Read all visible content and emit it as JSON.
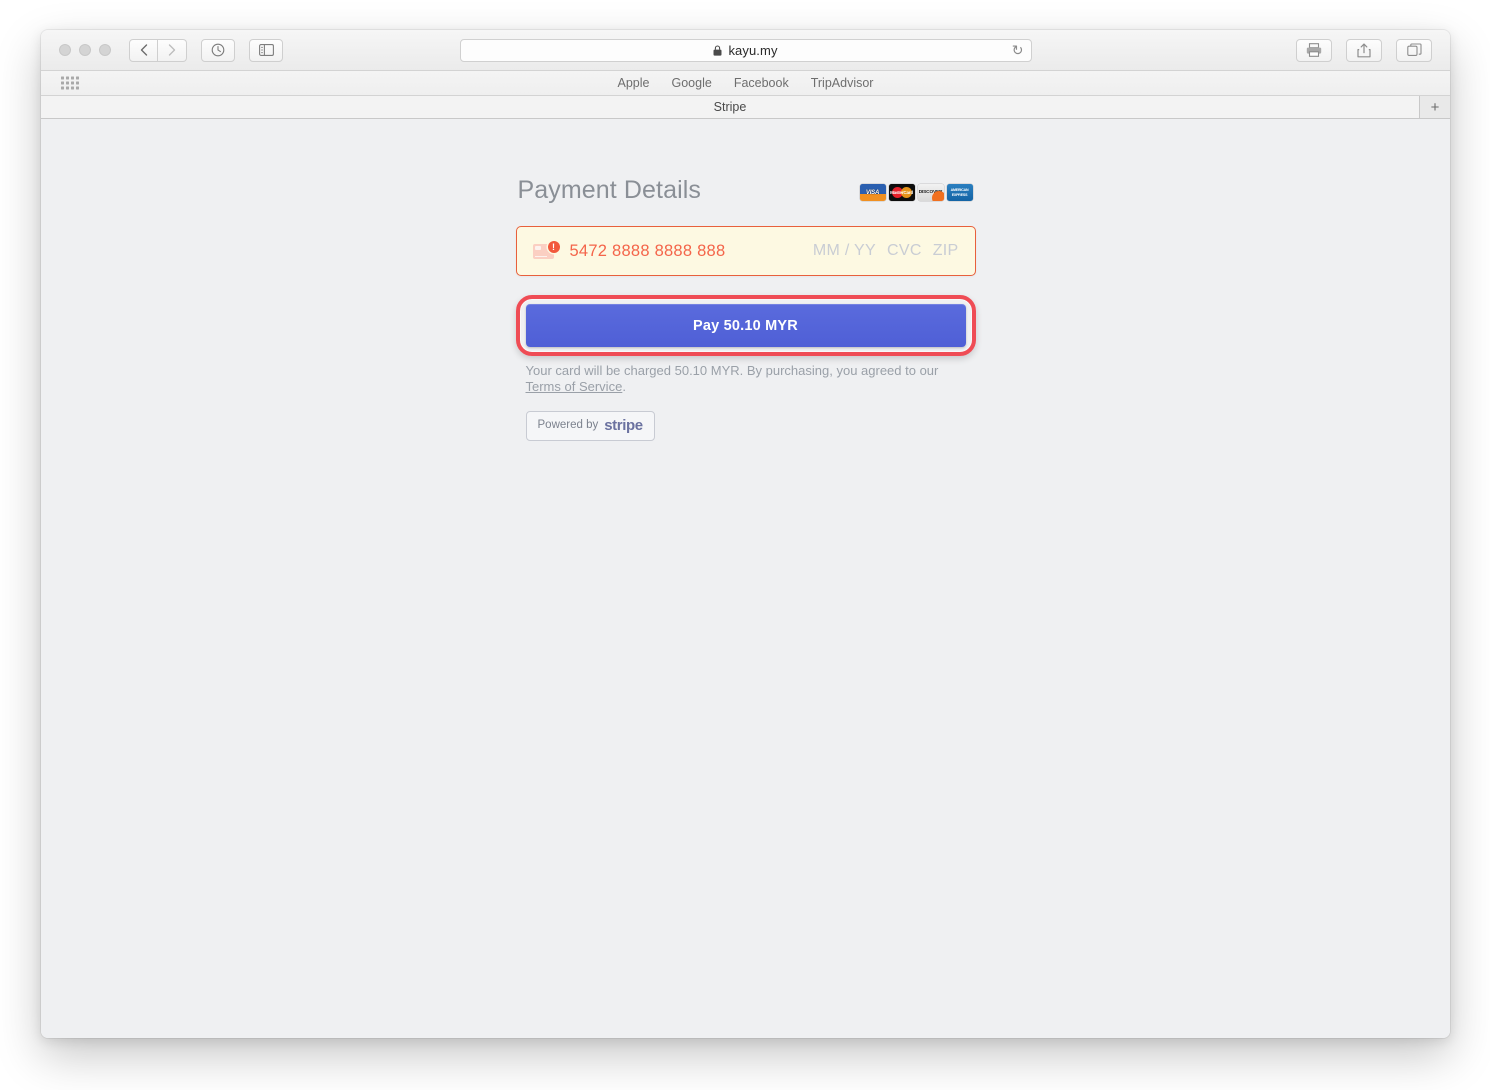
{
  "browser": {
    "window_controls": [
      "close",
      "minimize",
      "zoom"
    ],
    "nav": {
      "back_label": "‹",
      "forward_label": "›",
      "history_icon": "clock-icon",
      "sidebar_icon": "sidebar-icon"
    },
    "url": {
      "lock_icon": "lock-icon",
      "text": "kayu.my",
      "reload_label": "↻"
    },
    "toolbar_right": {
      "print_icon": "print-icon",
      "share_icon": "share-icon",
      "tabs_overview_icon": "tab-overview-icon"
    },
    "bookmarks": {
      "grid_icon": "bookmarks-grid-icon",
      "items": [
        "Apple",
        "Google",
        "Facebook",
        "TripAdvisor"
      ]
    },
    "tabs": {
      "active_title": "Stripe",
      "new_tab_label": "+"
    }
  },
  "page": {
    "title": "Payment Details",
    "card_brands": [
      {
        "name": "visa",
        "label": "VISA"
      },
      {
        "name": "mastercard",
        "label": "MasterCard"
      },
      {
        "name": "discover",
        "label": "DISCOVER"
      },
      {
        "name": "amex",
        "label": "AMERICAN EXPRESS"
      }
    ],
    "card_field": {
      "card_icon": "credit-card-icon",
      "error_badge": "!",
      "number_value": "5472 8888 8888 888",
      "expiry_placeholder": "MM / YY",
      "cvc_placeholder": "CVC",
      "zip_placeholder": "ZIP",
      "state": "error",
      "error_color": "#f4654a",
      "background_color": "#fdf9e2",
      "border_color": "#e8603c"
    },
    "pay_button": {
      "label": "Pay 50.10 MYR",
      "color": "#5562d6",
      "focus_ring_color": "#ef4c55"
    },
    "legal": {
      "text_before": "Your card will be charged 50.10 MYR. By purchasing, you agreed to our ",
      "link": "Terms of Service",
      "text_after": "."
    },
    "stripe_badge": {
      "powered_by": "Powered by",
      "brand": "stripe"
    }
  }
}
